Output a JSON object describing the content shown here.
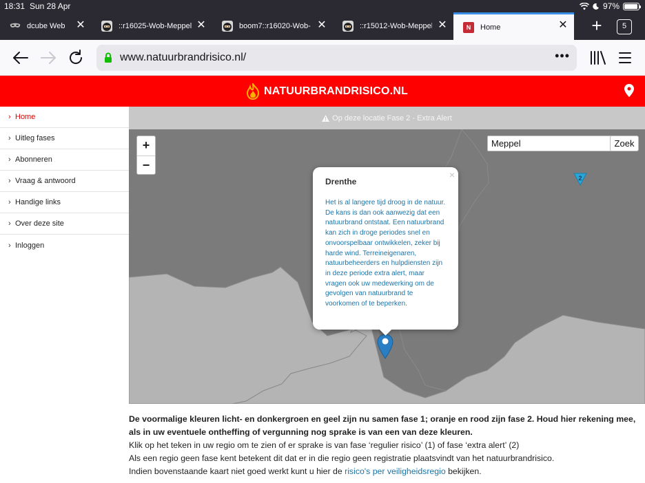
{
  "status_bar": {
    "time": "18:31",
    "date": "Sun 28 Apr",
    "battery": "97%"
  },
  "tabs": [
    {
      "title": "dcube Web",
      "favicon": "mask-icon",
      "active": false
    },
    {
      "title": "::r16025-Wob-Meppel",
      "favicon": "ninja-icon",
      "active": false
    },
    {
      "title": "boom7::r16020-Wob-",
      "favicon": "ninja-icon",
      "active": false
    },
    {
      "title": "::r15012-Wob-Meppel",
      "favicon": "ninja-icon",
      "active": false
    },
    {
      "title": "Home",
      "favicon": "N",
      "active": true
    }
  ],
  "tab_count": "5",
  "toolbar": {
    "url": "www.natuurbrandrisico.nl/"
  },
  "site": {
    "logo_text": "NATUURBRANDRISICO.NL",
    "brand_color": "#ff0000"
  },
  "sidebar": {
    "items": [
      {
        "label": "Home",
        "active": true
      },
      {
        "label": "Uitleg fases",
        "active": false
      },
      {
        "label": "Abonneren",
        "active": false
      },
      {
        "label": "Vraag & antwoord",
        "active": false
      },
      {
        "label": "Handige links",
        "active": false
      },
      {
        "label": "Over deze site",
        "active": false
      },
      {
        "label": "Inloggen",
        "active": false
      }
    ]
  },
  "alert_bar": {
    "text": "Op deze locatie Fase 2 - Extra Alert"
  },
  "map": {
    "zoom_in": "+",
    "zoom_out": "−",
    "search_value": "Meppel",
    "search_button": "Zoek",
    "marker_label": "2",
    "popup": {
      "title": "Drenthe",
      "body": "Het is al langere tijd droog in de natuur. De kans is dan ook aanwezig dat een natuurbrand ontstaat. Een natuurbrand kan zich in droge periodes snel en onvoorspelbaar ontwikkelen, zeker bij harde wind. Terreineigenaren, natuurbeheerders en hulpdiensten zijn in deze periode extra alert, maar vragen ook uw medewerking om de gevolgen van natuurbrand te voorkomen of te beperken.",
      "close": "×"
    }
  },
  "content": {
    "bold_text": "De voormalige kleuren licht- en donkergroen en geel zijn nu samen fase 1; oranje en rood zijn fase 2. Houd hier rekening mee, als in uw eventuele ontheffing of vergunning nog sprake is van een van deze kleuren.",
    "line2": "Klik op het teken in uw regio om te zien of er sprake is van fase ‘regulier risico’ (1) of fase ‘extra alert’ (2)",
    "line3": "Als een regio geen fase kent betekent dit dat er in die regio geen registratie plaatsvindt van het natuurbrandrisico.",
    "line4_pre": "Indien bovenstaande kaart niet goed werkt kunt u hier de ",
    "line4_link": "risico's per veiligheidsregio",
    "line4_post": " bekijken."
  }
}
